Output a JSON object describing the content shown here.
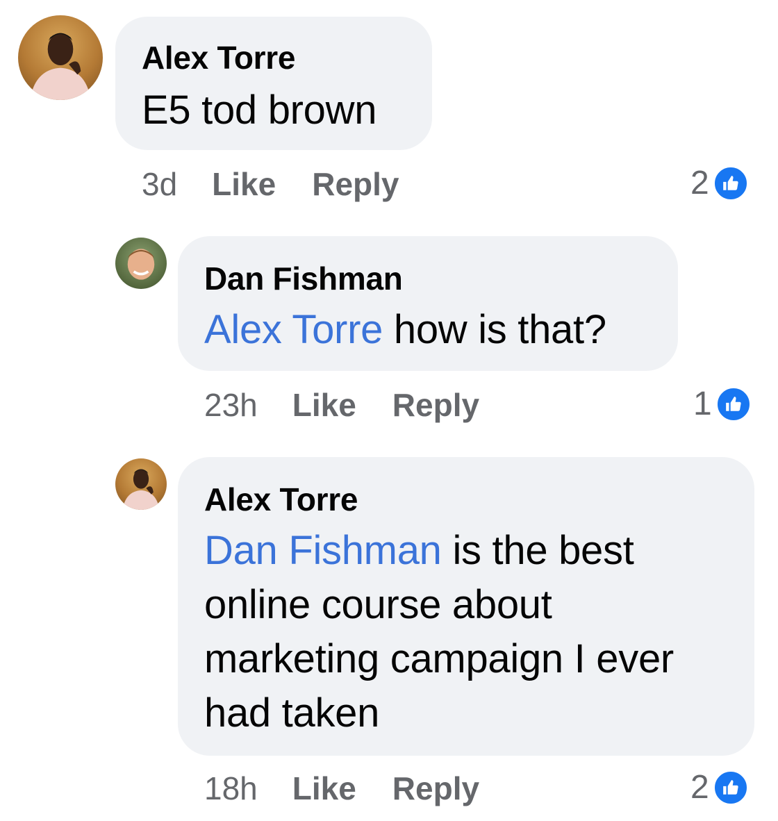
{
  "comments": [
    {
      "author": "Alex Torre",
      "mention": "",
      "text": "E5 tod brown",
      "time": "3d",
      "like_label": "Like",
      "reply_label": "Reply",
      "reaction_count": "2",
      "avatar_icon": "profile-photo-alex-torre"
    },
    {
      "author": "Dan Fishman",
      "mention": "Alex Torre",
      "text": "how is that?",
      "time": "23h",
      "like_label": "Like",
      "reply_label": "Reply",
      "reaction_count": "1",
      "avatar_icon": "profile-photo-dan-fishman"
    },
    {
      "author": "Alex Torre",
      "mention": "Dan Fishman",
      "text_line1": "is the best",
      "text_line2": "online course about",
      "text_line3": "marketing campaign I ever",
      "text_line4": "had taken",
      "time": "18h",
      "like_label": "Like",
      "reply_label": "Reply",
      "reaction_count": "2",
      "avatar_icon": "profile-photo-alex-torre"
    }
  ],
  "colors": {
    "bubble": "#f0f2f5",
    "mention": "#3b73d9",
    "meta": "#65676b",
    "like_badge": "#1877f2"
  },
  "reaction_icon": "thumbs-up-icon"
}
